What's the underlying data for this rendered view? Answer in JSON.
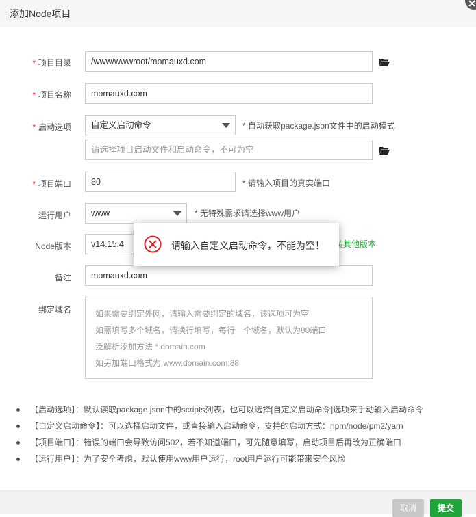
{
  "dialog": {
    "title": "添加Node项目"
  },
  "form": {
    "dir": {
      "label": "项目目录",
      "value": "/www/wwwroot/momauxd.com"
    },
    "name": {
      "label": "项目名称",
      "value": "momauxd.com"
    },
    "startup": {
      "label": "启动选项",
      "selected": "自定义启动命令",
      "hint": "* 自动获取package.json文件中的启动模式",
      "command_placeholder": "请选择项目启动文件和启动命令，不可为空"
    },
    "port": {
      "label": "项目端口",
      "value": "80",
      "hint": "* 请输入项目的真实端口"
    },
    "user": {
      "label": "运行用户",
      "selected": "www",
      "hint": "* 无特殊需求请选择www用户"
    },
    "node": {
      "label": "Node版本",
      "selected": "v14.15.4",
      "link": "装其他版本"
    },
    "remark": {
      "label": "备注",
      "value": "momauxd.com"
    },
    "domain": {
      "label": "绑定域名",
      "placeholder_lines": [
        "如果需要绑定外网，请输入需要绑定的域名，该选项可为空",
        "如需填写多个域名，请换行填写，每行一个域名，默认为80端口",
        "泛解析添加方法 *.domain.com",
        "如另加端口格式为 www.domain.com:88"
      ]
    }
  },
  "notes": [
    "【启动选项】：默认读取package.json中的scripts列表，也可以选择[自定义启动命令]选项来手动输入启动命令",
    "【自定义启动命令】：可以选择启动文件，或直接输入启动命令，支持的启动方式：npm/node/pm2/yarn",
    "【项目端口】：错误的端口会导致访问502，若不知道端口，可先随意填写，启动项目后再改为正确端口",
    "【运行用户】：为了安全考虑，默认使用www用户运行，root用户运行可能带来安全风险"
  ],
  "footer": {
    "cancel": "取消",
    "submit": "提交"
  },
  "toast": {
    "message": "请输入自定义启动命令，不能为空！"
  },
  "colors": {
    "accent": "#20a53a",
    "required": "#e02020",
    "error": "#e02020"
  }
}
